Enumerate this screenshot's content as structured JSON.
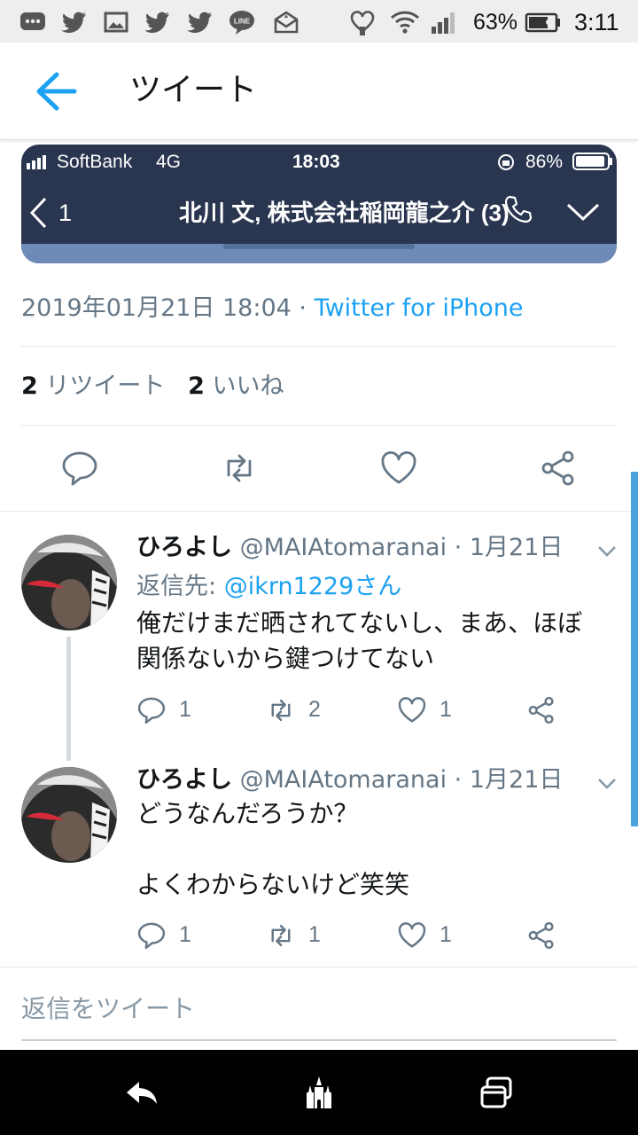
{
  "status_bar": {
    "battery_percent": "63%",
    "time": "3:11",
    "icons": [
      "chat-icon",
      "twitter-icon",
      "image-icon",
      "twitter-icon",
      "twitter-icon",
      "line-icon",
      "mail-icon",
      "heart-badge-icon",
      "wifi-icon",
      "signal-icon",
      "battery-icon"
    ]
  },
  "header": {
    "title": "ツイート",
    "back_icon": "arrow-left-icon",
    "accent": "#1da1f2"
  },
  "embedded_image": {
    "status": {
      "carrier": "SoftBank",
      "network": "4G",
      "time": "18:03",
      "battery": "86%"
    },
    "chat": {
      "back_count": "1",
      "title": "北川 文, 株式会社稲岡龍之介 (3)",
      "company_mark_top": "株式",
      "company_mark_bottom": "会社"
    }
  },
  "tweet": {
    "timestamp": "2019年01月21日 18:04",
    "separator": " · ",
    "source": "Twitter for iPhone",
    "retweets_count": "2",
    "retweets_label": "リツイート",
    "likes_count": "2",
    "likes_label": "いいね",
    "actions": [
      "reply-icon",
      "retweet-icon",
      "like-icon",
      "share-icon"
    ]
  },
  "replies": [
    {
      "name": "ひろよし",
      "handle": "@MAIAtomaranai",
      "date": "· 1月21日",
      "reply_to_label": "返信先: ",
      "reply_to_handle": "@ikrn1229さん",
      "text": "俺だけまだ晒されてないし、まあ、ほぼ\n関係ないから鍵つけてない",
      "reply_count": "1",
      "retweet_count": "2",
      "like_count": "1"
    },
    {
      "name": "ひろよし",
      "handle": "@MAIAtomaranai",
      "date": "· 1月21日",
      "text": "どうなんだろうか？\n\nよくわからないけど笑笑",
      "reply_count": "1",
      "retweet_count": "1",
      "like_count": "1"
    }
  ],
  "compose": {
    "placeholder": "返信をツイート"
  },
  "nav_bar": {
    "icons": [
      "back-nav-icon",
      "castle-icon",
      "recent-apps-icon"
    ]
  }
}
